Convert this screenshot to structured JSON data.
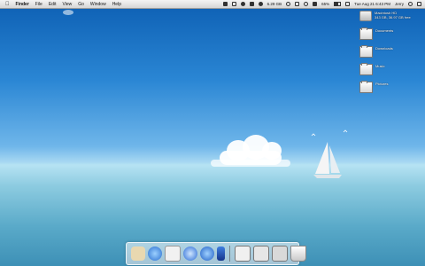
{
  "menubar": {
    "app_name": "Finder",
    "menus": [
      "File",
      "Edit",
      "View",
      "Go",
      "Window",
      "Help"
    ],
    "status": {
      "disk_space": "6.29 GB",
      "battery": "65%",
      "clock": "Tue Aug 21  6:43 PM",
      "user": "Jerry"
    }
  },
  "desktop": {
    "items": [
      {
        "label": "Macintosh HD",
        "sublabel": "343 GB, 36.97 GB free",
        "kind": "drive"
      },
      {
        "label": "Documents",
        "kind": "folder"
      },
      {
        "label": "Downloads",
        "kind": "folder"
      },
      {
        "label": "Music",
        "kind": "folder"
      },
      {
        "label": "Pictures",
        "kind": "folder"
      }
    ]
  },
  "dock": {
    "apps": [
      {
        "name": "finder-icon",
        "color": "#e9d8b0"
      },
      {
        "name": "safari-icon",
        "color": "#3b8fe0"
      },
      {
        "name": "mail-icon",
        "color": "#f1f1f1"
      },
      {
        "name": "itunes-icon",
        "color": "#2a6bd6"
      },
      {
        "name": "music-icon",
        "color": "#3a7ed8"
      },
      {
        "name": "xcode-icon",
        "color": "#1b4fb0"
      }
    ],
    "stacks": [
      {
        "name": "downloads-stack-icon"
      },
      {
        "name": "documents-stack-icon"
      },
      {
        "name": "applications-stack-icon"
      },
      {
        "name": "trash-icon"
      }
    ]
  }
}
